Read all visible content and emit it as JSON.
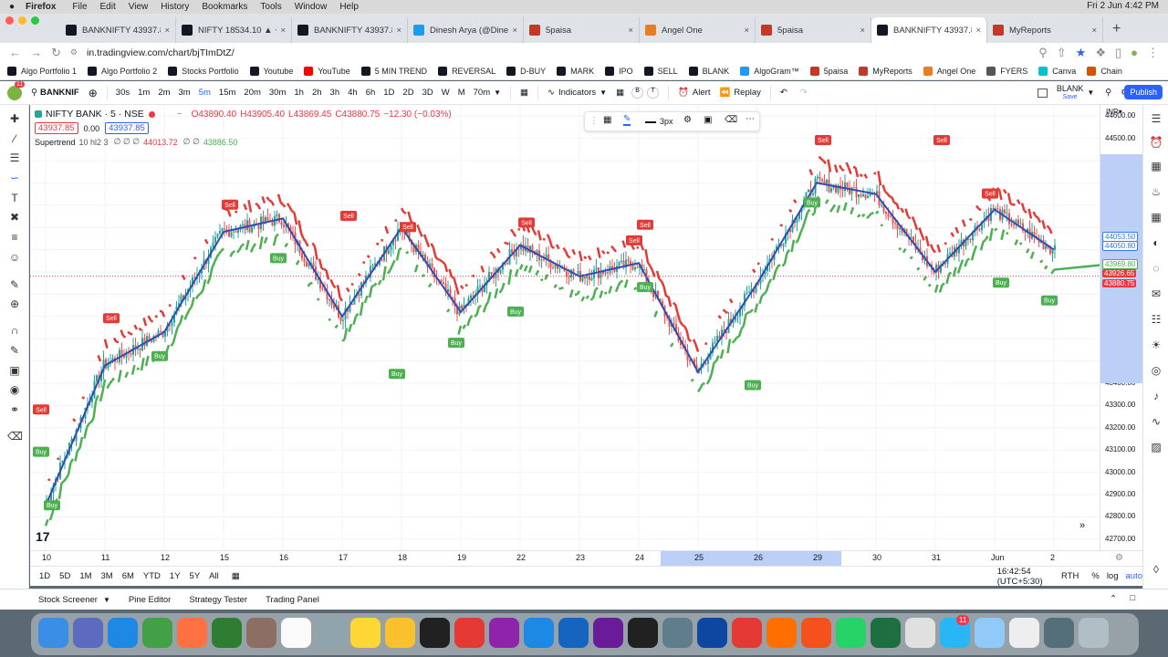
{
  "menubar": {
    "app": "Firefox",
    "items": [
      "File",
      "Edit",
      "View",
      "History",
      "Bookmarks",
      "Tools",
      "Window",
      "Help"
    ],
    "clock": "Fri 2 Jun  4:42 PM"
  },
  "tabs": [
    {
      "label": "BANKNIFTY 43937.85",
      "color": "#131722"
    },
    {
      "label": "NIFTY 18534.10 ▲ +0.",
      "color": "#131722"
    },
    {
      "label": "BANKNIFTY 43937.85",
      "color": "#131722"
    },
    {
      "label": "Dinesh Arya (@Dinesh",
      "color": "#1d9bf0"
    },
    {
      "label": "5paisa",
      "color": "#c0392b"
    },
    {
      "label": "Angel One",
      "color": "#e67e22"
    },
    {
      "label": "5paisa",
      "color": "#c0392b"
    },
    {
      "label": "BANKNIFTY 43937.85",
      "color": "#131722"
    },
    {
      "label": "MyReports",
      "color": "#c0392b"
    }
  ],
  "url": "in.tradingview.com/chart/bjTImDtZ/",
  "bookmarks": [
    {
      "label": "Algo Portfolio 1",
      "color": "#131722"
    },
    {
      "label": "Algo Portfolio 2",
      "color": "#131722"
    },
    {
      "label": "Stocks Portfolio",
      "color": "#131722"
    },
    {
      "label": "Youtube",
      "color": "#131722"
    },
    {
      "label": "YouTube",
      "color": "#ff0000"
    },
    {
      "label": "5 MIN TREND",
      "color": "#131722"
    },
    {
      "label": "REVERSAL",
      "color": "#131722"
    },
    {
      "label": "D-BUY",
      "color": "#131722"
    },
    {
      "label": "MARK",
      "color": "#131722"
    },
    {
      "label": "IPO",
      "color": "#131722"
    },
    {
      "label": "SELL",
      "color": "#131722"
    },
    {
      "label": "BLANK",
      "color": "#131722"
    },
    {
      "label": "AlgoGram™",
      "color": "#1d9bf0"
    },
    {
      "label": "5paisa",
      "color": "#c0392b"
    },
    {
      "label": "MyReports",
      "color": "#c0392b"
    },
    {
      "label": "Angel One",
      "color": "#e67e22"
    },
    {
      "label": "FYERS",
      "color": "#555555"
    },
    {
      "label": "Canva",
      "color": "#00c4cc"
    },
    {
      "label": "Chain",
      "color": "#d35400"
    }
  ],
  "toolbar": {
    "symbol": "BANKNIF",
    "timeframes": [
      "30s",
      "1m",
      "2m",
      "3m",
      "5m",
      "15m",
      "20m",
      "30m",
      "1h",
      "2h",
      "3h",
      "4h",
      "6h",
      "1D",
      "2D",
      "3D",
      "W",
      "M",
      "70m"
    ],
    "active_tf": "5m",
    "indicators": "Indicators",
    "alert": "Alert",
    "replay": "Replay",
    "layout_name": "BLANK",
    "layout_sub": "Save",
    "publish": "Publish",
    "notif_count": "11"
  },
  "legend": {
    "title": "NIFTY BANK · 5 · NSE",
    "open": "O43890.40",
    "high": "H43905.40",
    "low": "L43869.45",
    "close": "C43880.75",
    "change": "−12.30 (−0.03%)",
    "bid": "43937.85",
    "spread": "0.00",
    "ask": "43937.85",
    "indicator": "Supertrend",
    "params": "10 hl2 3",
    "ind_dots": "∅ ∅ ∅",
    "ind_val1": "44013.72",
    "ind_dots2": "∅ ∅",
    "ind_val2": "43886.50"
  },
  "drawing_toolbar": {
    "width_label": "3px"
  },
  "price_axis": {
    "currency": "INR▾",
    "ticks": [
      "44600.00",
      "44500.00",
      "44400.00",
      "44300.00",
      "44200.00",
      "44100.00",
      "44000.00",
      "43900.00",
      "43800.00",
      "43700.00",
      "43600.00",
      "43500.00",
      "43400.00",
      "43300.00",
      "43200.00",
      "43100.00",
      "43000.00",
      "42900.00",
      "42800.00",
      "42700.00"
    ],
    "tags": [
      {
        "v": "44053.50",
        "color": "#3179f5"
      },
      {
        "v": "44050.80",
        "color": "#3179f5"
      },
      {
        "v": "43969.80",
        "color": "#4caf50"
      },
      {
        "v": "43926.65",
        "color": "#e53935"
      },
      {
        "v": "43880.75",
        "color": "#f23645"
      }
    ]
  },
  "time_axis": {
    "labels": [
      "10",
      "11",
      "12",
      "15",
      "16",
      "17",
      "18",
      "19",
      "22",
      "23",
      "24",
      "25",
      "26",
      "29",
      "30",
      "31",
      "Jun",
      "2"
    ]
  },
  "range_bar": {
    "ranges": [
      "1D",
      "5D",
      "1M",
      "3M",
      "6M",
      "YTD",
      "1Y",
      "5Y",
      "All"
    ],
    "time": "16:42:54 (UTC+5:30)",
    "session": "RTH",
    "pct": "%",
    "log": "log",
    "auto": "auto"
  },
  "bottom_panel": {
    "items": [
      "Stock Screener",
      "Pine Editor",
      "Strategy Tester",
      "Trading Panel"
    ]
  },
  "dock_badge": "11",
  "chart_data": {
    "type": "line",
    "title": "NIFTY BANK · 5 · NSE",
    "ylim": [
      42650,
      44650
    ],
    "x": [
      "10",
      "11",
      "12",
      "15",
      "16",
      "17",
      "18",
      "19",
      "22",
      "23",
      "24",
      "25",
      "26",
      "29",
      "30",
      "31",
      "Jun",
      "2"
    ],
    "series": [
      {
        "name": "Supertrend",
        "values": [
          42850,
          43480,
          43630,
          44080,
          44140,
          43700,
          44100,
          43720,
          44020,
          43880,
          43940,
          43450,
          43850,
          44300,
          44250,
          43900,
          44180,
          44000
        ]
      }
    ],
    "signals": [
      {
        "label": "Sell",
        "x": "10",
        "y": 43280
      },
      {
        "label": "Buy",
        "x": "10",
        "y": 42850
      },
      {
        "label": "Buy",
        "x": "10",
        "y": 43090
      },
      {
        "label": "Sell",
        "x": "11",
        "y": 43690
      },
      {
        "label": "Buy",
        "x": "12",
        "y": 43520
      },
      {
        "label": "Sell",
        "x": "15",
        "y": 44200
      },
      {
        "label": "Buy",
        "x": "16",
        "y": 43960
      },
      {
        "label": "Sell",
        "x": "17",
        "y": 44150
      },
      {
        "label": "Buy",
        "x": "18",
        "y": 43440
      },
      {
        "label": "Sell",
        "x": "18",
        "y": 44100
      },
      {
        "label": "Buy",
        "x": "19",
        "y": 43580
      },
      {
        "label": "Sell",
        "x": "22",
        "y": 44120
      },
      {
        "label": "Buy",
        "x": "22",
        "y": 43720
      },
      {
        "label": "Sell",
        "x": "24",
        "y": 44110
      },
      {
        "label": "Sell",
        "x": "24",
        "y": 44040
      },
      {
        "label": "Buy",
        "x": "24",
        "y": 43830
      },
      {
        "label": "Buy",
        "x": "26",
        "y": 43390
      },
      {
        "label": "Sell",
        "x": "29",
        "y": 44490
      },
      {
        "label": "Buy",
        "x": "29",
        "y": 44210
      },
      {
        "label": "Sell",
        "x": "31",
        "y": 44490
      },
      {
        "label": "Sell",
        "x": "Jun",
        "y": 44250
      },
      {
        "label": "Buy",
        "x": "Jun",
        "y": 43850
      },
      {
        "label": "Buy",
        "x": "2",
        "y": 43770
      }
    ],
    "colors": {
      "up": "#4caf50",
      "down": "#e53935",
      "candle_up": "#26a69a",
      "candle_down": "#ef5350",
      "trendline": "#2f4cb3"
    }
  }
}
